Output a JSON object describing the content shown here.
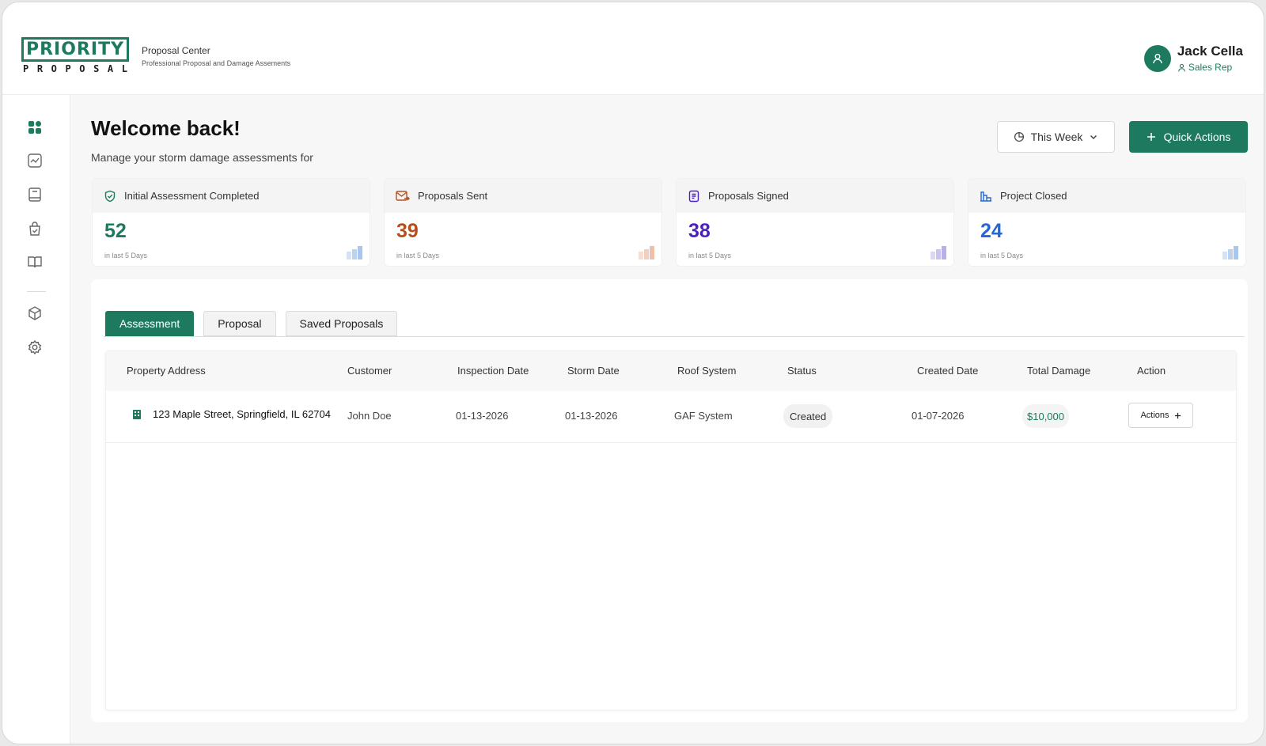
{
  "app": {
    "logo_main": "PRIORITY",
    "logo_sub": [
      "P",
      "R",
      "O",
      "P",
      "O",
      "S",
      "A",
      "L"
    ],
    "title": "Proposal Center",
    "subtitle": "Professional Proposal and Damage Assements"
  },
  "user": {
    "name": "Jack Cella",
    "role": "Sales Rep"
  },
  "sidebar": {
    "items": [
      {
        "icon": "dashboard-icon",
        "active": true
      },
      {
        "icon": "activity-icon",
        "active": false
      },
      {
        "icon": "document-icon",
        "active": false
      },
      {
        "icon": "bag-check-icon",
        "active": false
      },
      {
        "icon": "book-icon",
        "active": false
      },
      {
        "icon": "box-icon",
        "active": false
      },
      {
        "icon": "settings-icon",
        "active": false
      }
    ]
  },
  "main": {
    "welcome": "Welcome back!",
    "subtitle": "Manage your storm damage assessments for",
    "period_label": "This Week",
    "quick_actions_label": "Quick Actions"
  },
  "stats": [
    {
      "label": "Initial Assessment Completed",
      "value": "52",
      "note": "in last 5 Days",
      "icon": "shield-check-icon",
      "color": "#1d7a5f",
      "chart_color": "#bcd3f0"
    },
    {
      "label": "Proposals Sent",
      "value": "39",
      "note": "in last 5 Days",
      "icon": "mail-send-icon",
      "color": "#b54f1e",
      "chart_color": "#f3cdbd"
    },
    {
      "label": "Proposals Signed",
      "value": "38",
      "note": "in last 5 Days",
      "icon": "clipboard-icon",
      "color": "#4b1fc4",
      "chart_color": "#cbc3ee"
    },
    {
      "label": "Project Closed",
      "value": "24",
      "note": "in last 5 Days",
      "icon": "building-chart-icon",
      "color": "#2566d4",
      "chart_color": "#bcd3f0"
    }
  ],
  "tabs": [
    {
      "label": "Assessment",
      "active": true
    },
    {
      "label": "Proposal",
      "active": false
    },
    {
      "label": "Saved Proposals",
      "active": false
    }
  ],
  "table": {
    "headers": [
      "Property Address",
      "Customer",
      "Inspection Date",
      "Storm Date",
      "Roof System",
      "Status",
      "Created Date",
      "Total Damage",
      "Action"
    ],
    "rows": [
      {
        "address": "123 Maple Street, Springfield, IL 62704",
        "customer": "John Doe",
        "inspection_date": "01-13-2026",
        "storm_date": "01-13-2026",
        "roof_system": "GAF System",
        "status": "Created",
        "created_date": "01-07-2026",
        "total_damage": "$10,000",
        "action_label": "Actions"
      }
    ]
  },
  "colors": {
    "brand": "#1d7a5f"
  }
}
